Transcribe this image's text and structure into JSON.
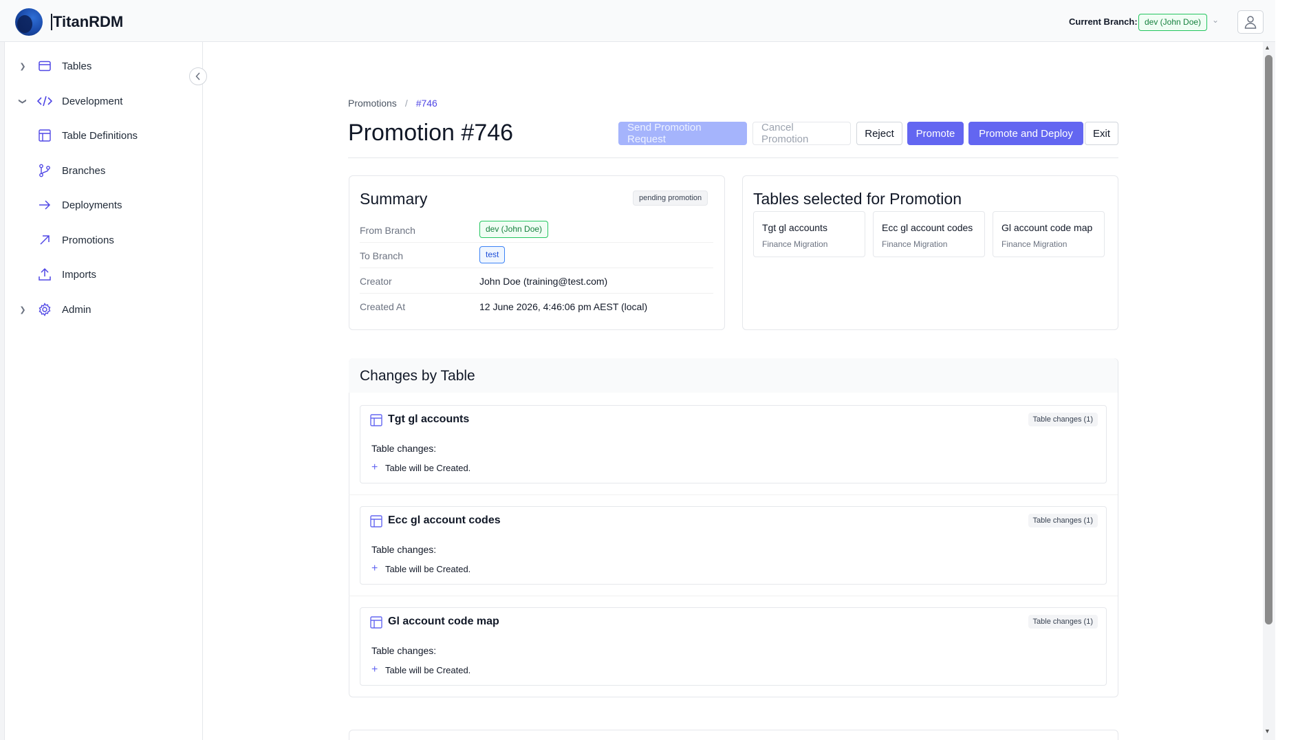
{
  "app": {
    "name": "TitanRDM"
  },
  "header": {
    "branch_label": "Current Branch:",
    "branch_value": "dev (John Doe)",
    "user_icon": "user-icon"
  },
  "sidebar": {
    "items": [
      {
        "label": "Tables",
        "icon": "table-icon",
        "expanded": false
      },
      {
        "label": "Development",
        "icon": "code-icon",
        "expanded": true
      },
      {
        "label": "Table Definitions",
        "icon": "grid-icon"
      },
      {
        "label": "Branches",
        "icon": "git-branch-icon"
      },
      {
        "label": "Deployments",
        "icon": "arrow-right-icon"
      },
      {
        "label": "Promotions",
        "icon": "arrow-up-right-icon"
      },
      {
        "label": "Imports",
        "icon": "upload-icon"
      },
      {
        "label": "Admin",
        "icon": "gear-icon",
        "expanded": false
      }
    ]
  },
  "breadcrumb": {
    "parent": "Promotions",
    "separator": "/",
    "current": "#746"
  },
  "page": {
    "title": "Promotion #746"
  },
  "actions": {
    "send": "Send Promotion Request",
    "cancel": "Cancel Promotion",
    "reject": "Reject",
    "promote": "Promote",
    "promote_deploy": "Promote and Deploy",
    "exit": "Exit"
  },
  "summary": {
    "title": "Summary",
    "status": "pending promotion",
    "rows": [
      {
        "key": "From Branch",
        "value": "dev (John Doe)"
      },
      {
        "key": "To Branch",
        "value": "test"
      },
      {
        "key": "Creator",
        "value": "John Doe (training@test.com)"
      },
      {
        "key": "Created At",
        "value": "12 June 2026, 4:46:06 pm AEST (local)"
      }
    ]
  },
  "selected_tables": {
    "title": "Tables selected for Promotion",
    "items": [
      {
        "name": "Tgt gl accounts",
        "sub": "Finance Migration"
      },
      {
        "name": "Ecc gl account codes",
        "sub": "Finance Migration"
      },
      {
        "name": "Gl account code map",
        "sub": "Finance Migration"
      }
    ]
  },
  "changes": {
    "title": "Changes by Table",
    "items": [
      {
        "name": "Tgt gl accounts",
        "badge": "Table changes (1)",
        "label": "Table changes:",
        "change": "Table will be Created."
      },
      {
        "name": "Ecc gl account codes",
        "badge": "Table changes (1)",
        "label": "Table changes:",
        "change": "Table will be Created."
      },
      {
        "name": "Gl account code map",
        "badge": "Table changes (1)",
        "label": "Table changes:",
        "change": "Table will be Created."
      }
    ]
  },
  "colors": {
    "accent": "#6366f1",
    "accent_disabled": "#a5b4fc",
    "branch_green": "#15803d",
    "branch_blue": "#1d4ed8"
  }
}
